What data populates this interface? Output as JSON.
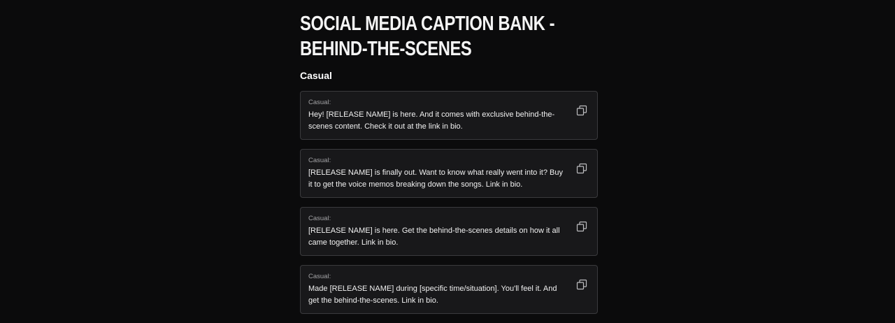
{
  "page": {
    "title": "SOCIAL MEDIA CAPTION BANK - BEHIND-THE-SCENES"
  },
  "section": {
    "heading": "Casual"
  },
  "captions": [
    {
      "label": "Casual:",
      "text": "Hey! [RELEASE NAME] is here. And it comes with exclusive behind-the-scenes content. Check it out at the link in bio.",
      "copy_icon": "copy-icon"
    },
    {
      "label": "Casual:",
      "text": "[RELEASE NAME] is finally out. Want to know what really went into it? Buy it to get the voice memos breaking down the songs. Link in bio.",
      "copy_icon": "copy-icon"
    },
    {
      "label": "Casual:",
      "text": "[RELEASE NAME] is here. Get the behind-the-scenes details on how it all came together. Link in bio.",
      "copy_icon": "copy-icon"
    },
    {
      "label": "Casual:",
      "text": "Made [RELEASE NAME] during [specific time/situation]. You'll feel it. And get the behind-the-scenes. Link in bio.",
      "copy_icon": "copy-icon"
    }
  ],
  "colors": {
    "background": "#0b0b0c",
    "card_background": "#18181a",
    "card_border": "#3a3a3d",
    "text": "#f1f1f1",
    "muted_text": "#a3a3a6"
  }
}
